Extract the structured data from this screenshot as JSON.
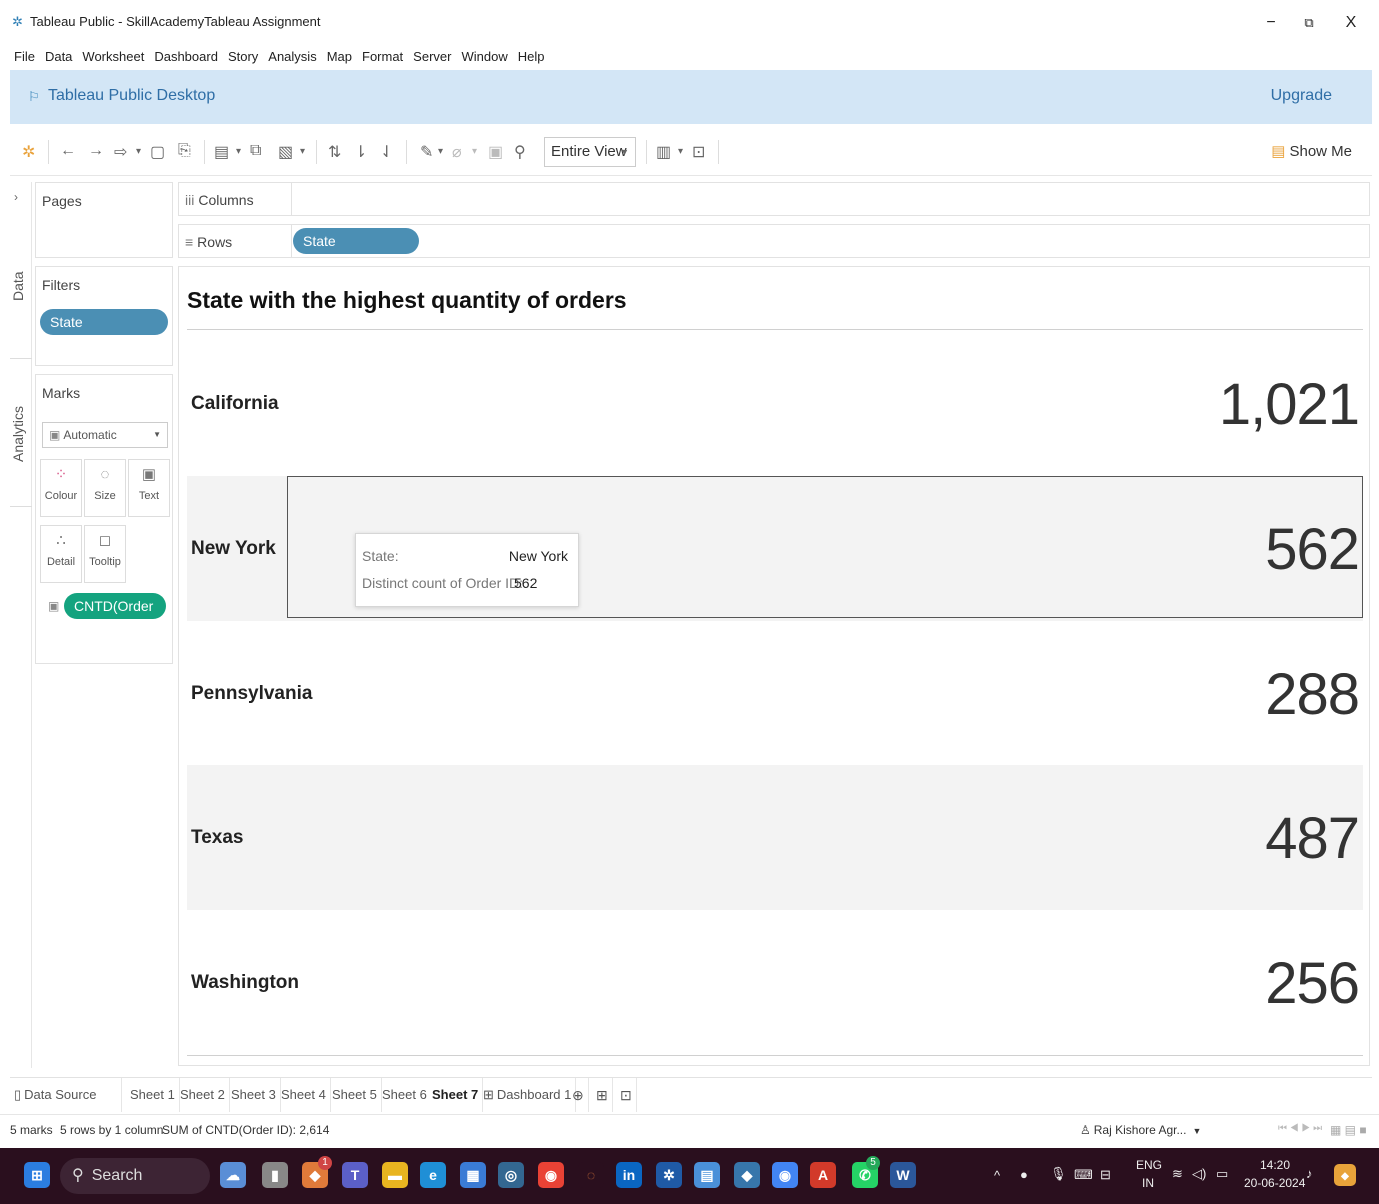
{
  "window": {
    "title": "Tableau Public - SkillAcademyTableau Assignment",
    "minimize": "−",
    "restore": "⧉",
    "close": "X"
  },
  "menu": [
    "File",
    "Data",
    "Worksheet",
    "Dashboard",
    "Story",
    "Analysis",
    "Map",
    "Format",
    "Server",
    "Window",
    "Help"
  ],
  "banner": {
    "label": "Tableau Public Desktop",
    "upgrade": "Upgrade"
  },
  "toolbar": {
    "view_select": "Entire View",
    "show_me": "Show Me"
  },
  "side_tabs": {
    "data": "Data",
    "analytics": "Analytics"
  },
  "pages": {
    "title": "Pages"
  },
  "filters": {
    "title": "Filters",
    "pill": "State"
  },
  "marks": {
    "title": "Marks",
    "type": "Automatic",
    "buttons": [
      "Colour",
      "Size",
      "Text",
      "Detail",
      "Tooltip"
    ],
    "field_pill": "CNTD(Order ID)"
  },
  "shelves": {
    "columns_label": "Columns",
    "rows_label": "Rows",
    "rows_pill": "State"
  },
  "viz": {
    "title": "State with the highest quantity of orders",
    "rows": [
      {
        "state": "California",
        "value": "1,021"
      },
      {
        "state": "New York",
        "value": "562"
      },
      {
        "state": "Pennsylvania",
        "value": "288"
      },
      {
        "state": "Texas",
        "value": "487"
      },
      {
        "state": "Washington",
        "value": "256"
      }
    ]
  },
  "tooltip": {
    "state_label": "State:",
    "state_value": "New York",
    "count_label": "Distinct count of Order ID:",
    "count_value": "562"
  },
  "sheet_tabs": {
    "data_source": "Data Source",
    "sheets": [
      "Sheet 1",
      "Sheet 2",
      "Sheet 3",
      "Sheet 4",
      "Sheet 5",
      "Sheet 6",
      "Sheet 7"
    ],
    "active": "Sheet 7",
    "dashboard": "Dashboard 1"
  },
  "status": {
    "marks": "5 marks",
    "layout": "5 rows by 1 column",
    "sum": "SUM of CNTD(Order ID): 2,614",
    "user": "Raj Kishore Agr..."
  },
  "taskbar": {
    "search": "Search",
    "lang": "ENG",
    "region": "IN",
    "time": "14:20",
    "date": "20-06-2024",
    "teams_badge": "1",
    "whatsapp_badge": "5"
  },
  "colors": {
    "banner_bg": "#d3e6f6",
    "dimension_pill": "#4b8fb4",
    "measure_pill": "#14a37f",
    "taskbar_bg": "#2a0f1e"
  }
}
